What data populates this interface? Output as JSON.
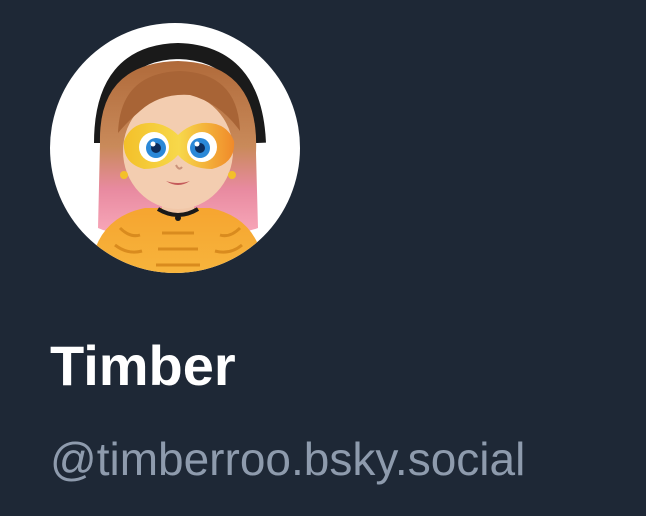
{
  "profile": {
    "display_name": "Timber",
    "handle": "@timberroo.bsky.social",
    "avatar_icon": "cartoon-avatar-icon"
  },
  "colors": {
    "background": "#1e2836",
    "name_text": "#ffffff",
    "handle_text": "#8e9bad",
    "avatar_ring": "#ffffff"
  }
}
